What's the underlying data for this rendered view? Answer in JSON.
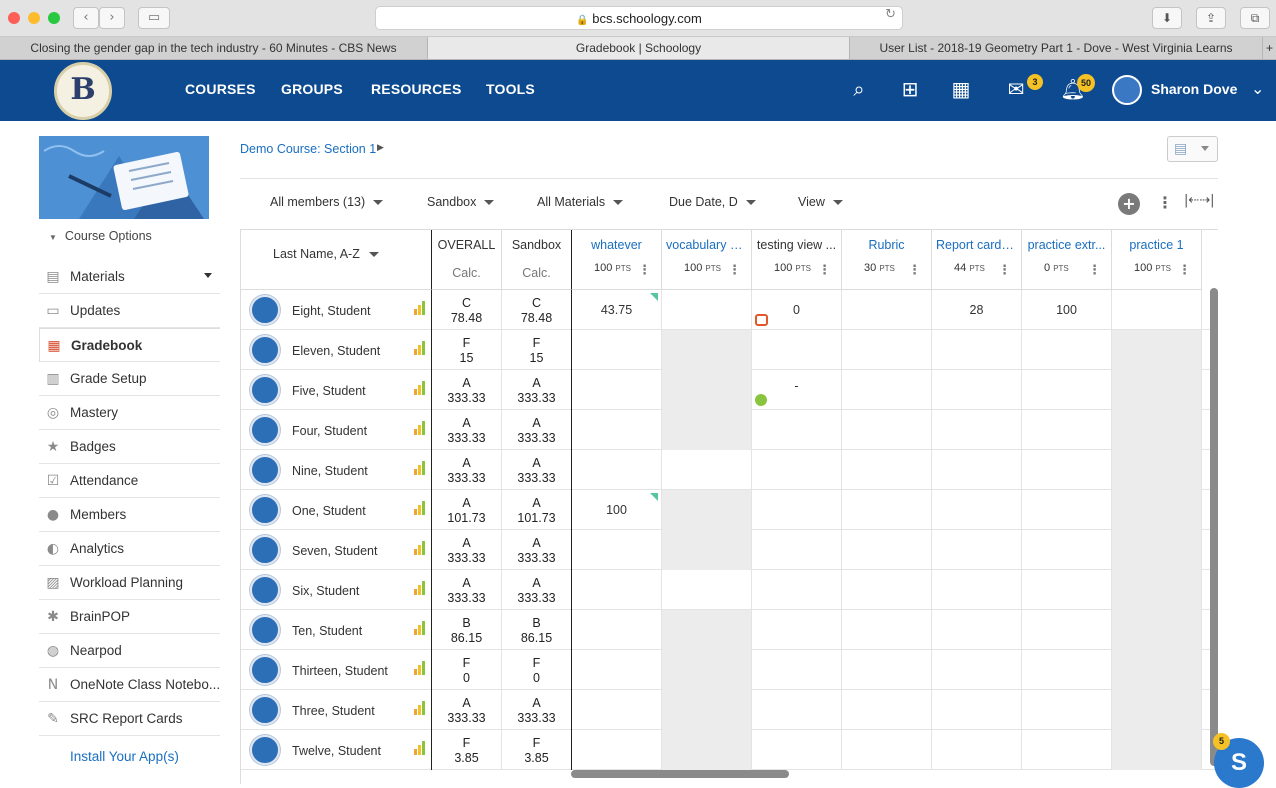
{
  "browser": {
    "url": "bcs.schoology.com",
    "tabs": [
      {
        "title": "Closing the gender gap in the tech industry - 60 Minutes - CBS News",
        "active": false
      },
      {
        "title": "Gradebook | Schoology",
        "active": true
      },
      {
        "title": "User List - 2018-19 Geometry Part 1 - Dove - West Virginia Learns",
        "active": false
      }
    ]
  },
  "header": {
    "nav": [
      "COURSES",
      "GROUPS",
      "RESOURCES",
      "TOOLS"
    ],
    "messages_count": "3",
    "notifications_count": "50",
    "user_name": "Sharon Dove"
  },
  "sidebar": {
    "course_options": "Course Options",
    "items": [
      {
        "label": "Materials",
        "icon": "materials-icon",
        "has_caret": true
      },
      {
        "label": "Updates",
        "icon": "updates-icon"
      },
      {
        "label": "Gradebook",
        "icon": "gradebook-icon",
        "active": true
      },
      {
        "label": "Grade Setup",
        "icon": "grade-setup-icon"
      },
      {
        "label": "Mastery",
        "icon": "mastery-icon"
      },
      {
        "label": "Badges",
        "icon": "badges-icon"
      },
      {
        "label": "Attendance",
        "icon": "attendance-icon"
      },
      {
        "label": "Members",
        "icon": "members-icon"
      },
      {
        "label": "Analytics",
        "icon": "analytics-icon"
      },
      {
        "label": "Workload Planning",
        "icon": "workload-icon"
      },
      {
        "label": "BrainPOP",
        "icon": "brainpop-icon"
      },
      {
        "label": "Nearpod",
        "icon": "nearpod-icon"
      },
      {
        "label": "OneNote Class Notebo...",
        "icon": "onenote-icon"
      },
      {
        "label": "SRC Report Cards",
        "icon": "report-cards-icon"
      }
    ],
    "install_apps": "Install Your App(s)"
  },
  "main": {
    "breadcrumb": "Demo Course: Section 1",
    "filters": [
      "All members (13)",
      "Sandbox",
      "All Materials",
      "Due Date, D",
      "View"
    ],
    "sort_label": "Last Name, A-Z"
  },
  "gradebook": {
    "summary_columns": [
      {
        "title": "OVERALL",
        "sub": "Calc."
      },
      {
        "title": "Sandbox",
        "sub": "Calc."
      }
    ],
    "assignments": [
      {
        "title": "whatever",
        "pts": "100",
        "link": true
      },
      {
        "title": "vocabulary p...",
        "pts": "100",
        "link": true
      },
      {
        "title": "testing view ...",
        "pts": "100",
        "link": false
      },
      {
        "title": "Rubric",
        "pts": "30",
        "link": true
      },
      {
        "title": "Report card t...",
        "pts": "44",
        "link": true
      },
      {
        "title": "practice extr...",
        "pts": "0",
        "link": true
      },
      {
        "title": "practice 1",
        "pts": "100",
        "link": true
      }
    ],
    "pts_suffix": "PTS",
    "students": [
      {
        "name": "Eight, Student",
        "overall": [
          "C",
          "78.48"
        ],
        "sandbox": [
          "C",
          "78.48"
        ],
        "scores": [
          "43.75",
          "",
          "0",
          "",
          "28",
          "100",
          ""
        ]
      },
      {
        "name": "Eleven, Student",
        "overall": [
          "F",
          "15"
        ],
        "sandbox": [
          "F",
          "15"
        ],
        "scores": [
          "",
          "",
          "",
          "",
          "",
          "",
          ""
        ]
      },
      {
        "name": "Five, Student",
        "overall": [
          "A",
          "333.33"
        ],
        "sandbox": [
          "A",
          "333.33"
        ],
        "scores": [
          "",
          "",
          "-",
          "",
          "",
          "",
          ""
        ]
      },
      {
        "name": "Four, Student",
        "overall": [
          "A",
          "333.33"
        ],
        "sandbox": [
          "A",
          "333.33"
        ],
        "scores": [
          "",
          "",
          "",
          "",
          "",
          "",
          ""
        ]
      },
      {
        "name": "Nine, Student",
        "overall": [
          "A",
          "333.33"
        ],
        "sandbox": [
          "A",
          "333.33"
        ],
        "scores": [
          "",
          "",
          "",
          "",
          "",
          "",
          ""
        ]
      },
      {
        "name": "One, Student",
        "overall": [
          "A",
          "101.73"
        ],
        "sandbox": [
          "A",
          "101.73"
        ],
        "scores": [
          "100",
          "",
          "",
          "",
          "",
          "",
          ""
        ]
      },
      {
        "name": "Seven, Student",
        "overall": [
          "A",
          "333.33"
        ],
        "sandbox": [
          "A",
          "333.33"
        ],
        "scores": [
          "",
          "",
          "",
          "",
          "",
          "",
          ""
        ]
      },
      {
        "name": "Six, Student",
        "overall": [
          "A",
          "333.33"
        ],
        "sandbox": [
          "A",
          "333.33"
        ],
        "scores": [
          "",
          "",
          "",
          "",
          "",
          "",
          ""
        ]
      },
      {
        "name": "Ten, Student",
        "overall": [
          "B",
          "86.15"
        ],
        "sandbox": [
          "B",
          "86.15"
        ],
        "scores": [
          "",
          "",
          "",
          "",
          "",
          "",
          ""
        ]
      },
      {
        "name": "Thirteen, Student",
        "overall": [
          "F",
          "0"
        ],
        "sandbox": [
          "F",
          "0"
        ],
        "scores": [
          "",
          "",
          "",
          "",
          "",
          "",
          ""
        ]
      },
      {
        "name": "Three, Student",
        "overall": [
          "A",
          "333.33"
        ],
        "sandbox": [
          "A",
          "333.33"
        ],
        "scores": [
          "",
          "",
          "",
          "",
          "",
          "",
          ""
        ]
      },
      {
        "name": "Twelve, Student",
        "overall": [
          "F",
          "3.85"
        ],
        "sandbox": [
          "F",
          "3.85"
        ],
        "scores": [
          "",
          "",
          "",
          "",
          "",
          "",
          ""
        ]
      }
    ]
  },
  "chat": {
    "label": "S",
    "badge": "5"
  },
  "colors": {
    "header": "#0d4a8f",
    "link": "#1a6ec0",
    "badge": "#f5c225"
  }
}
